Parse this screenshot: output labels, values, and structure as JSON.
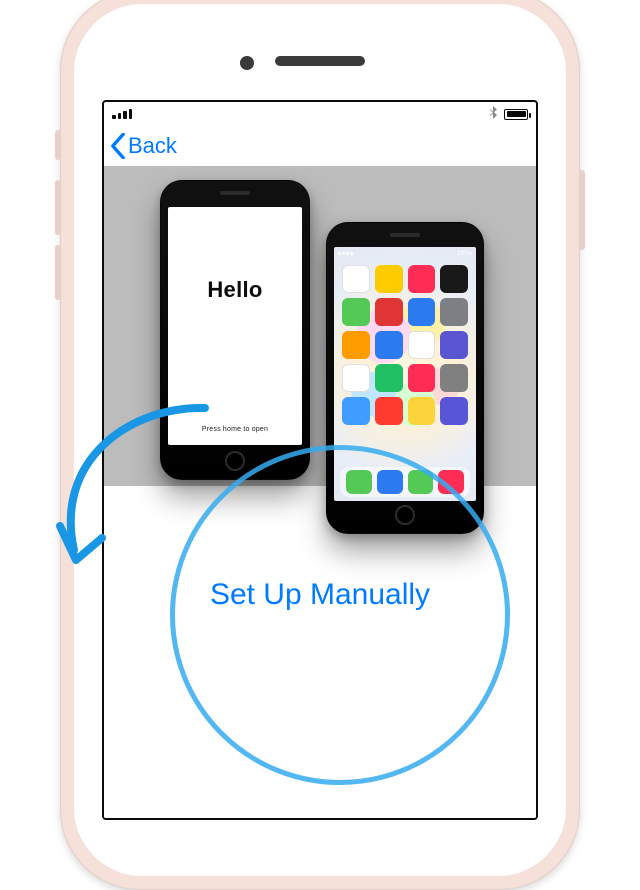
{
  "nav": {
    "back_label": "Back"
  },
  "hero": {
    "left_phone": {
      "hello": "Hello",
      "press_home": "Press home to open"
    },
    "right_phone": {
      "app_icons": [
        {
          "bg": "#ffffff",
          "label": "calendar"
        },
        {
          "bg": "#ffcc00",
          "label": "notes"
        },
        {
          "bg": "#ff2d55",
          "label": "health"
        },
        {
          "bg": "#191919",
          "label": "wallet"
        },
        {
          "bg": "#54c956",
          "label": "phone"
        },
        {
          "bg": "#e03535",
          "label": "youtube"
        },
        {
          "bg": "#2c7af0",
          "label": "appstore"
        },
        {
          "bg": "#7e7e85",
          "label": "settings"
        },
        {
          "bg": "#ff9c00",
          "label": "books"
        },
        {
          "bg": "#2c7af0",
          "label": "files"
        },
        {
          "bg": "#ffffff",
          "label": "home"
        },
        {
          "bg": "#5a56d1",
          "label": "podcasts"
        },
        {
          "bg": "#ffffff",
          "label": "clock"
        },
        {
          "bg": "#21c064",
          "label": "facetime"
        },
        {
          "bg": "#ff2d55",
          "label": "music"
        },
        {
          "bg": "#808080",
          "label": "camera"
        },
        {
          "bg": "#409cff",
          "label": "mail"
        },
        {
          "bg": "#ff3b30",
          "label": "news"
        },
        {
          "bg": "#fcd33b",
          "label": "photos"
        },
        {
          "bg": "#5856d6",
          "label": "itunes"
        }
      ],
      "dock_icons": [
        {
          "bg": "#54c956"
        },
        {
          "bg": "#2c7af0"
        },
        {
          "bg": "#54c956"
        },
        {
          "bg": "#ff2d55"
        }
      ]
    }
  },
  "actions": {
    "setup_manually": "Set Up Manually"
  },
  "colors": {
    "accent": "#007aff",
    "anno": "#35aaf0"
  }
}
